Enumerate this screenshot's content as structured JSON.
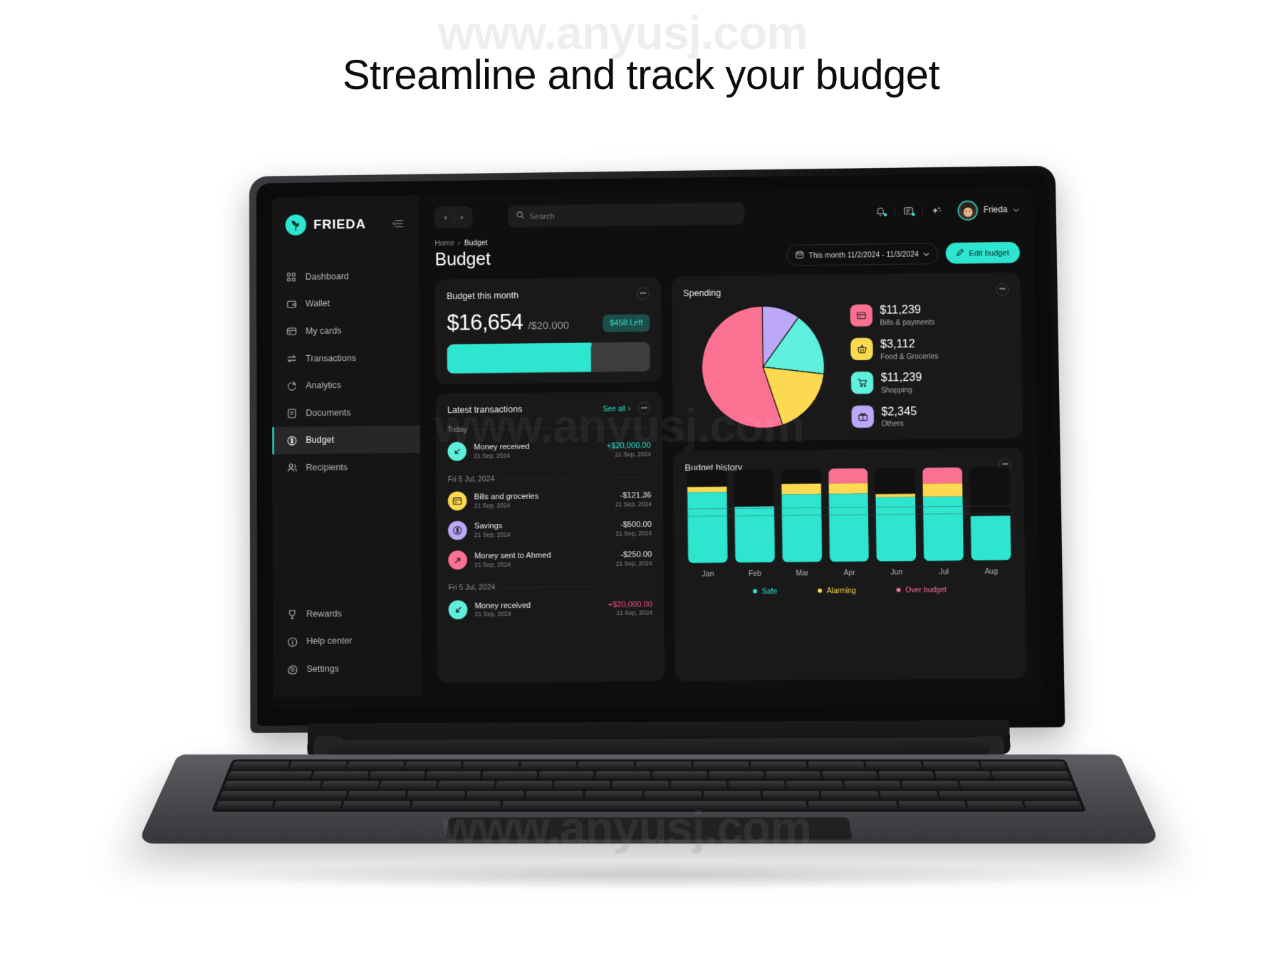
{
  "headline": "Streamline and track your budget",
  "watermark": "www.anyusj.com",
  "brand": {
    "name": "FRIEDA",
    "accent": "#2ee6d0"
  },
  "sidebar": {
    "collapse_icon": "collapse-icon",
    "items": [
      {
        "label": "Dashboard",
        "icon": "grid-icon",
        "active": false
      },
      {
        "label": "Wallet",
        "icon": "wallet-icon",
        "active": false
      },
      {
        "label": "My cards",
        "icon": "card-icon",
        "active": false
      },
      {
        "label": "Transactions",
        "icon": "transfer-icon",
        "active": false
      },
      {
        "label": "Analytics",
        "icon": "pie-icon",
        "active": false
      },
      {
        "label": "Documents",
        "icon": "document-icon",
        "active": false
      },
      {
        "label": "Budget",
        "icon": "dollar-circle-icon",
        "active": true
      },
      {
        "label": "Recipients",
        "icon": "people-icon",
        "active": false
      }
    ],
    "bottom_items": [
      {
        "label": "Rewards",
        "icon": "trophy-icon"
      },
      {
        "label": "Help center",
        "icon": "info-icon"
      },
      {
        "label": "Settings",
        "icon": "gear-icon"
      }
    ]
  },
  "topbar": {
    "back": "‹",
    "forward": "›",
    "search_placeholder": "Search",
    "icons": [
      "bell-icon",
      "message-icon",
      "sparkle-icon"
    ],
    "user_name": "Frieda",
    "user_chevron": "⌄"
  },
  "breadcrumb": {
    "home": "Home",
    "sep": "›",
    "current": "Budget"
  },
  "page": {
    "title": "Budget",
    "date_range": "This month 11/2/2024 - 11/3/2024",
    "edit_button": "Edit budget"
  },
  "budget_card": {
    "title": "Budget this month",
    "spent": "$16,654",
    "total": "/$20.000",
    "left_badge": "$458 Left",
    "progress_percent": 71
  },
  "transactions_card": {
    "title": "Latest transactions",
    "see_all": "See all",
    "see_all_chevron": "›",
    "groups": [
      {
        "label": "Today",
        "items": [
          {
            "name": "Money received",
            "date": "21 Sep, 2024",
            "amount": "+$20,000.00",
            "right_date": "21 Sep, 2024",
            "tone": "pos",
            "icon": "arrow-down-left-icon",
            "color": "#5ef0dc"
          }
        ]
      },
      {
        "label": "Fri 5 Jul, 2024",
        "items": [
          {
            "name": "Bills and groceries",
            "date": "21 Sep, 2024",
            "amount": "-$121.36",
            "right_date": "21 Sep, 2024",
            "tone": "neg",
            "icon": "card-icon",
            "color": "#fbd950"
          },
          {
            "name": "Savings",
            "date": "21 Sep, 2024",
            "amount": "-$500.00",
            "right_date": "21 Sep, 2024",
            "tone": "neg",
            "icon": "dollar-circle-icon",
            "color": "#bda8f7"
          },
          {
            "name": "Money sent to Ahmed",
            "date": "21 Sep, 2024",
            "amount": "-$250.00",
            "right_date": "21 Sep, 2024",
            "tone": "neg",
            "icon": "arrow-up-right-icon",
            "color": "#fb7192"
          }
        ]
      },
      {
        "label": "Fri 5 Jul, 2024",
        "items": [
          {
            "name": "Money received",
            "date": "21 Sep, 2024",
            "amount": "+$20,000.00",
            "right_date": "21 Sep, 2024",
            "tone": "alt",
            "icon": "arrow-down-left-icon",
            "color": "#5ef0dc"
          }
        ]
      }
    ]
  },
  "spending_card": {
    "title": "Spending",
    "legend": [
      {
        "amount": "$11,239",
        "label": "Bills & payments",
        "color": "#fb7192",
        "icon": "card-icon"
      },
      {
        "amount": "$3,112",
        "label": "Food & Groceries",
        "color": "#fbd950",
        "icon": "basket-icon"
      },
      {
        "amount": "$11,239",
        "label": "Shopping",
        "color": "#5ef0dc",
        "icon": "cart-icon"
      },
      {
        "amount": "$2,345",
        "label": "Others",
        "color": "#bda8f7",
        "icon": "gift-icon"
      }
    ]
  },
  "history_card": {
    "title": "Budget history",
    "legend": [
      {
        "label": "Safe",
        "color": "#2ee6d0"
      },
      {
        "label": "Alarming",
        "color": "#fbd950"
      },
      {
        "label": "Over budget",
        "color": "#fb7192"
      }
    ]
  },
  "chart_data": [
    {
      "type": "pie",
      "title": "Spending",
      "labels": [
        "Bills & payments",
        "Food & Groceries",
        "Shopping",
        "Others"
      ],
      "values": [
        11239,
        3112,
        11239,
        2345
      ],
      "colors": [
        "#fb7192",
        "#fbd950",
        "#5ef0dc",
        "#bda8f7"
      ],
      "slices_percent": [
        55,
        18,
        17,
        10
      ],
      "legend": "right"
    },
    {
      "type": "bar",
      "title": "Budget history",
      "stacked": true,
      "categories": [
        "Jan",
        "Feb",
        "Mar",
        "Apr",
        "Jun",
        "Jul",
        "Aug"
      ],
      "ylim": [
        0,
        100
      ],
      "grid": true,
      "series": [
        {
          "name": "Safe",
          "color": "#2ee6d0",
          "values": [
            76,
            60,
            73,
            73,
            69,
            69,
            48
          ]
        },
        {
          "name": "Alarming",
          "color": "#fbd950",
          "values": [
            6,
            0,
            11,
            11,
            3,
            14,
            0
          ]
        },
        {
          "name": "Over budget",
          "color": "#fb7192",
          "values": [
            0,
            0,
            0,
            16,
            0,
            17,
            0
          ]
        }
      ],
      "legend": "bottom"
    }
  ]
}
